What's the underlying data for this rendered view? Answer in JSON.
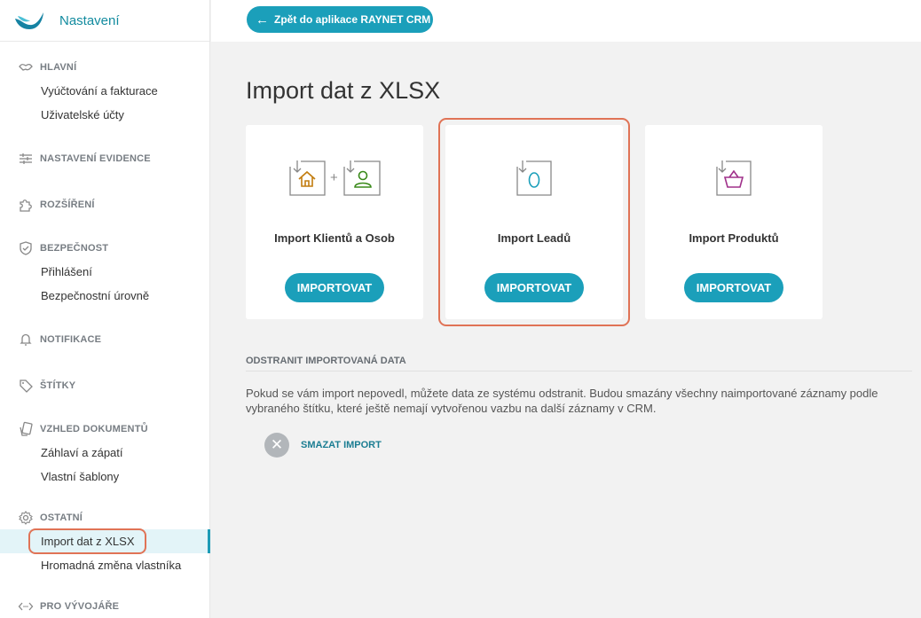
{
  "sidebar": {
    "brand": "Nastavení",
    "sections": {
      "main": {
        "label": "HLAVNÍ",
        "items": [
          "Vyúčtování a fakturace",
          "Uživatelské účty"
        ]
      },
      "records": {
        "label": "NASTAVENÍ EVIDENCE"
      },
      "extensions": {
        "label": "ROZŠÍŘENÍ"
      },
      "security": {
        "label": "BEZPEČNOST",
        "items": [
          "Přihlášení",
          "Bezpečnostní úrovně"
        ]
      },
      "notifications": {
        "label": "NOTIFIKACE"
      },
      "tags": {
        "label": "ŠTÍTKY"
      },
      "docs": {
        "label": "VZHLED DOKUMENTŮ",
        "items": [
          "Záhlaví a zápatí",
          "Vlastní šablony"
        ]
      },
      "other": {
        "label": "OSTATNÍ",
        "items": [
          "Import dat z XLSX",
          "Hromadná změna vlastníka"
        ]
      },
      "dev": {
        "label": "PRO VÝVOJÁŘE"
      }
    },
    "active_item": "Import dat z XLSX"
  },
  "topbar": {
    "back_label": "Zpět do aplikace RAYNET CRM"
  },
  "main": {
    "title": "Import dat z XLSX",
    "cards": [
      {
        "label": "Import Klientů a Osob",
        "button": "IMPORTOVAT"
      },
      {
        "label": "Import Leadů",
        "button": "IMPORTOVAT"
      },
      {
        "label": "Import Produktů",
        "button": "IMPORTOVAT"
      }
    ],
    "delete": {
      "heading": "ODSTRANIT IMPORTOVANÁ DATA",
      "text": "Pokud se vám import nepovedl, můžete data ze systému odstranit. Budou smazány všechny naimportované záznamy podle vybraného štítku, které ještě nemají vytvořenou vazbu na další záznamy v CRM.",
      "button": "SMAZAT IMPORT"
    }
  },
  "colors": {
    "accent": "#1b9fba",
    "highlight": "#e07356",
    "brand": "#128b9f"
  },
  "icons": [
    "logo-icon",
    "handshake-icon",
    "sliders-icon",
    "puzzle-icon",
    "shield-icon",
    "bell-icon",
    "tag-icon",
    "document-icon",
    "gear-icon",
    "code-icon",
    "arrow-left-icon",
    "import-house-icon",
    "import-person-icon",
    "import-egg-icon",
    "import-basket-icon",
    "close-icon"
  ]
}
